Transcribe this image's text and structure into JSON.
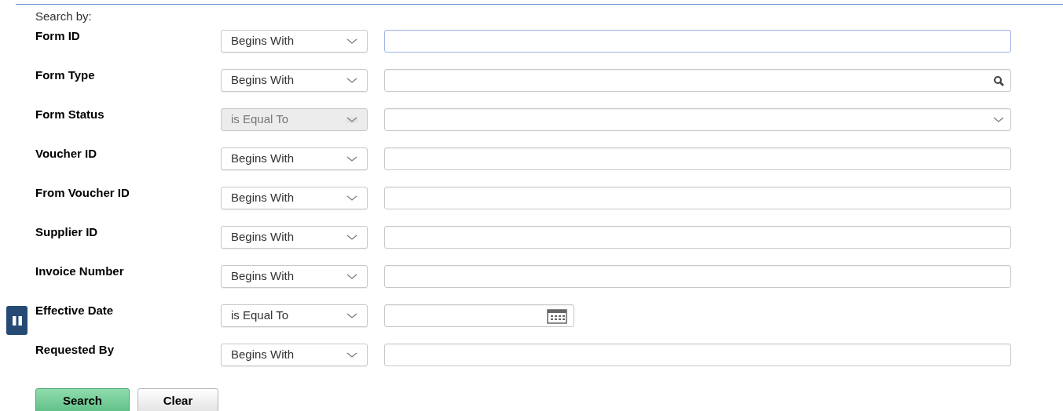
{
  "heading": "Search by:",
  "fields": [
    {
      "label": "Form ID",
      "operator": "Begins With",
      "operator_disabled": false,
      "kind": "text",
      "focused": true
    },
    {
      "label": "Form Type",
      "operator": "Begins With",
      "operator_disabled": false,
      "kind": "lookup",
      "focused": false
    },
    {
      "label": "Form Status",
      "operator": "is Equal To",
      "operator_disabled": true,
      "kind": "dropdown",
      "focused": false
    },
    {
      "label": "Voucher ID",
      "operator": "Begins With",
      "operator_disabled": false,
      "kind": "text",
      "focused": false
    },
    {
      "label": "From Voucher ID",
      "operator": "Begins With",
      "operator_disabled": false,
      "kind": "text",
      "focused": false
    },
    {
      "label": "Supplier ID",
      "operator": "Begins With",
      "operator_disabled": false,
      "kind": "text",
      "focused": false
    },
    {
      "label": "Invoice Number",
      "operator": "Begins With",
      "operator_disabled": false,
      "kind": "text",
      "focused": false
    },
    {
      "label": "Effective Date",
      "operator": "is Equal To",
      "operator_disabled": false,
      "kind": "date",
      "focused": false
    },
    {
      "label": "Requested By",
      "operator": "Begins With",
      "operator_disabled": false,
      "kind": "text",
      "focused": false
    }
  ],
  "buttons": [
    {
      "label": "Search",
      "kind": "primary"
    },
    {
      "label": "Clear",
      "kind": "secondary"
    }
  ]
}
